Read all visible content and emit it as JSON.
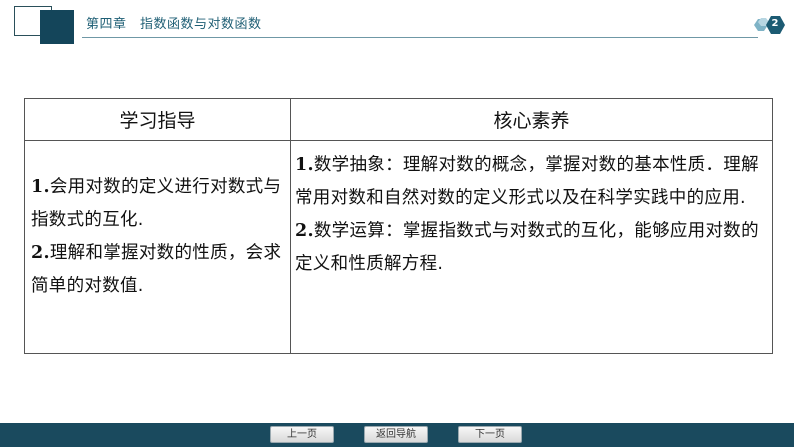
{
  "header": {
    "chapter_title": "第四章　指数函数与对数函数",
    "page_badge": "2"
  },
  "table": {
    "columns": [
      "学习指导",
      "核心素养"
    ],
    "guide": {
      "item1_num": "1.",
      "item1_text": "会用对数的定义进行对数式与指数式的互化.",
      "item2_num": "2.",
      "item2_text": "理解和掌握对数的性质，会求简单的对数值."
    },
    "literacy": {
      "item1_num": "1.",
      "item1_text": "数学抽象：理解对数的概念，掌握对数的基本性质．理解常用对数和自然对数的定义形式以及在科学实践中的应用.",
      "item2_num": "2.",
      "item2_text": "数学运算：掌握指数式与对数式的互化，能够应用对数的定义和性质解方程."
    }
  },
  "nav": {
    "prev_label": "上一页",
    "home_label": "返回导航",
    "next_label": "下一页"
  },
  "colors": {
    "header_dark": "#14455a",
    "header_text": "#1f5f75",
    "nav_bar": "#1a4a5e"
  }
}
